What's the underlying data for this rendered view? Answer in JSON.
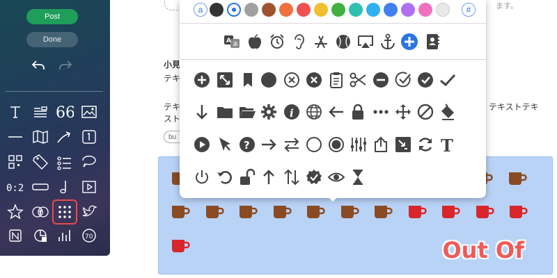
{
  "sidebar": {
    "post_label": "Post",
    "done_label": "Done"
  },
  "article": {
    "heading_fragment": "小見",
    "line1": "テキ",
    "line2a": "テキ",
    "line2b": "スト",
    "line2_right": "テキストテキ",
    "line1_right": "ます。",
    "chip_label": "bu"
  },
  "cup_panel": {
    "overlay_text": "Out Of",
    "filled_count": 10,
    "total_visible": 14,
    "filled_color": "#8a4b22",
    "empty_color": "#d8262b"
  },
  "picker": {
    "color_letter_left": "a",
    "color_letter_right": "#",
    "swatches": [
      "#333333",
      "#ffffff",
      "#a0a0a0",
      "#a0522d",
      "#f07040",
      "#f05050",
      "#f0c030",
      "#40b040",
      "#30c0b0",
      "#30b0f0",
      "#4080f0",
      "#b070f0",
      "#f070c0",
      "#e8e8e8"
    ],
    "selected_color": "#2b74e3",
    "icon_color": "#444444"
  }
}
